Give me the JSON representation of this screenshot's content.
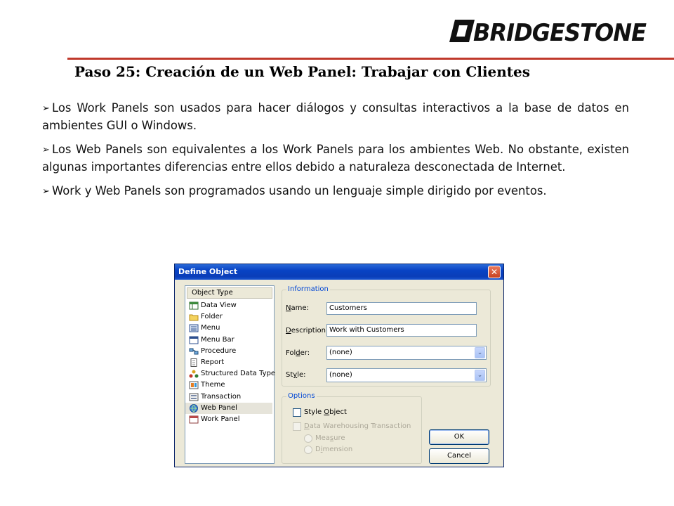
{
  "slide": {
    "logo_text": "BRIDGESTONE",
    "title": "Paso 25: Creación de un Web Panel: Trabajar con Clientes",
    "bullet_symbol": "➢",
    "bullets": [
      "Los Work Panels son usados para hacer diálogos y consultas interactivos a la base de datos en ambientes GUI o Windows.",
      "Los Web Panels son equivalentes a los Work Panels para los ambientes Web. No obstante, existen algunas importantes diferencias entre ellos debido a naturaleza desconectada de Internet.",
      "Work y Web Panels son programados usando un lenguaje simple dirigido por eventos."
    ],
    "colors": {
      "accent_rule": "#c0392b",
      "logo": "#111111"
    }
  },
  "dialog": {
    "title": "Define Object",
    "close_symbol": "✕",
    "object_type": {
      "header": "Object Type",
      "selected": "Web Panel",
      "items": [
        {
          "label": "Data View",
          "icon": "data-view-icon"
        },
        {
          "label": "Folder",
          "icon": "folder-icon"
        },
        {
          "label": "Menu",
          "icon": "menu-icon"
        },
        {
          "label": "Menu Bar",
          "icon": "menu-bar-icon"
        },
        {
          "label": "Procedure",
          "icon": "procedure-icon"
        },
        {
          "label": "Report",
          "icon": "report-icon"
        },
        {
          "label": "Structured Data Type",
          "icon": "structured-data-type-icon"
        },
        {
          "label": "Theme",
          "icon": "theme-icon"
        },
        {
          "label": "Transaction",
          "icon": "transaction-icon"
        },
        {
          "label": "Web Panel",
          "icon": "web-panel-icon"
        },
        {
          "label": "Work Panel",
          "icon": "work-panel-icon"
        }
      ]
    },
    "information": {
      "legend": "Information",
      "name_label": "ame:",
      "name_underline": "N",
      "name_value": "Customers",
      "description_label": "escription:",
      "description_underline": "D",
      "description_value": "Work with Customers",
      "folder_label_pre": "Fol",
      "folder_underline": "d",
      "folder_label_post": "er:",
      "folder_value": "(none)",
      "style_label_pre": "St",
      "style_underline": "y",
      "style_label_post": "le:",
      "style_value": "(none)",
      "dropdown_symbol": "⌄"
    },
    "options": {
      "legend": "Options",
      "style_object_pre": "Style ",
      "style_object_underline": "O",
      "style_object_post": "bject",
      "style_object_checked": false,
      "dw_pre": "",
      "dw_underline": "D",
      "dw_post": "ata Warehousing Transaction",
      "measure_pre": "Mea",
      "measure_underline": "s",
      "measure_post": "ure",
      "dimension_pre": "D",
      "dimension_underline": "i",
      "dimension_post": "mension"
    },
    "buttons": {
      "ok": "OK",
      "cancel": "Cancel"
    },
    "colors": {
      "titlebar": "#0a3db8",
      "legend": "#0046d5",
      "body": "#ece9d8",
      "selection": "#e6e4da"
    }
  }
}
